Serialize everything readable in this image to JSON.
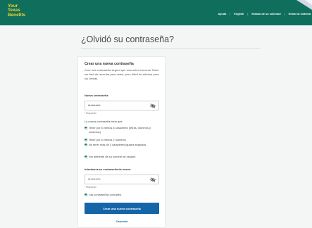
{
  "brand": {
    "line1": "Your",
    "line2": "Texas",
    "line3": "Benefits",
    "color": "#f3d230"
  },
  "header": {
    "bg": "#0f6f5c",
    "nav": [
      "Ayuda",
      "English",
      "Estado de su solicitud",
      "Entrar al sistema"
    ]
  },
  "page": {
    "title": "¿Olvidó su contraseña?"
  },
  "card": {
    "title": "Crear una nueva contraseña",
    "description": "Cree una contraseña segura que solo usted conozca. Debe ser fácil de recordar para usted, pero difícil de adivinar para los demás.",
    "new_password": {
      "label": "Nueva contraseña",
      "value": "••••••••••",
      "required": "* Requerido"
    },
    "rules_intro": "La nueva contraseña tiene que:",
    "rules": [
      "Tener por lo menos 8 caracteres (letras, números y símbolos)",
      "Tener por lo menos 2 números",
      "No tener más de 3 caracteres iguales seguidos",
      "Ser diferente de su nombre de usuario"
    ],
    "confirm_password": {
      "label": "Introduzca su contraseña de nuevo.",
      "value": "••••••••••",
      "required": "* Requerido"
    },
    "match_message": "Las contraseñas coinciden.",
    "submit_label": "Crear una nueva contraseña",
    "cancel_label": "Cancelar"
  }
}
